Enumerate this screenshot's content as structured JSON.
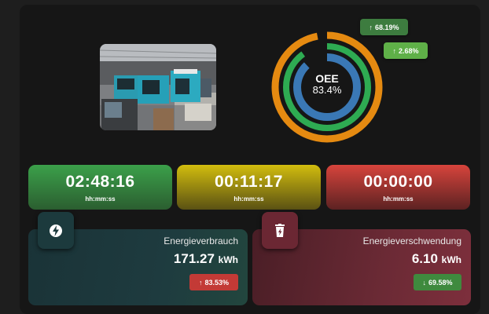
{
  "oee": {
    "label": "OEE",
    "value": "83.4%"
  },
  "rings": [
    {
      "name": "outer",
      "fraction": 0.97,
      "color": "#e58a11"
    },
    {
      "name": "middle",
      "fraction": 0.9,
      "color": "#2eab52"
    },
    {
      "name": "inner",
      "fraction": 0.88,
      "color": "#3a78b5"
    }
  ],
  "badges": {
    "top": {
      "arrow": "↑",
      "text": "68.19%",
      "color": "#3d7c3f"
    },
    "second": {
      "arrow": "↑",
      "text": "2.68%",
      "color": "#5fb048"
    }
  },
  "timers": [
    {
      "time": "02:48:16",
      "unit": "hh:mm:ss"
    },
    {
      "time": "00:11:17",
      "unit": "hh:mm:ss"
    },
    {
      "time": "00:00:00",
      "unit": "hh:mm:ss"
    }
  ],
  "energy": {
    "consumption": {
      "icon": "lightning-icon",
      "title": "Energieverbrauch",
      "value": "171.27",
      "unit": "kWh",
      "badge_arrow": "↑",
      "badge_text": "83.53%",
      "badge_color": "#c33a36"
    },
    "waste": {
      "icon": "trash-icon",
      "title": "Energieverschwendung",
      "value": "6.10",
      "unit": "kWh",
      "badge_arrow": "↓",
      "badge_text": "69.58%",
      "badge_color": "#3f8a3e"
    }
  }
}
